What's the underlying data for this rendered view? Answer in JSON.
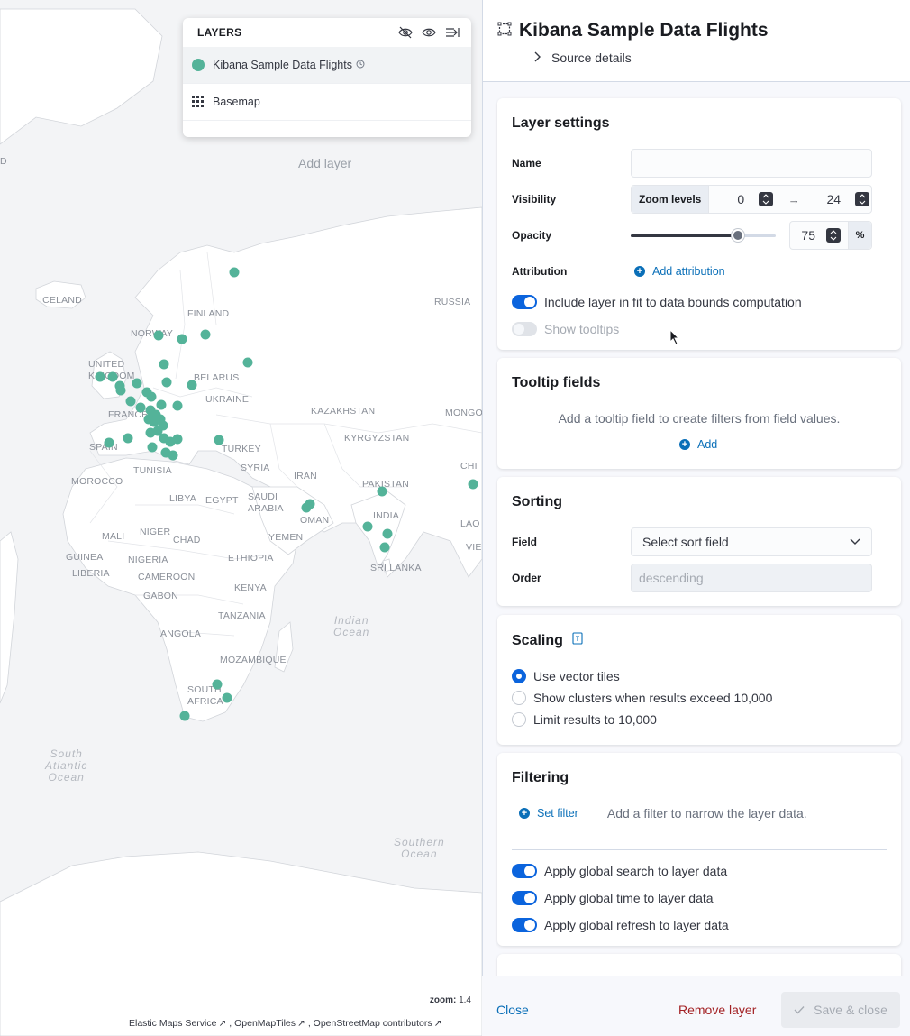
{
  "map": {
    "countries": [
      "ICELAND",
      "FINLAND",
      "NORWAY",
      "UNITED KINGDOM",
      "BELARUS",
      "UKRAINE",
      "FRANCE",
      "SPAIN",
      "TURKEY",
      "TUNISIA",
      "MOROCCO",
      "LIBYA",
      "EGYPT",
      "SAUDI ARABIA",
      "IRAN",
      "OMAN",
      "YEMEN",
      "MALI",
      "NIGER",
      "CHAD",
      "GUINEA",
      "NIGERIA",
      "LIBERIA",
      "CAMEROON",
      "ETHIOPIA",
      "GABON",
      "KENYA",
      "TANZANIA",
      "ANGOLA",
      "MOZAMBIQUE",
      "SOUTH AFRICA",
      "RUSSIA",
      "KAZAKHSTAN",
      "MONGOLIA",
      "KYRGYZSTAN",
      "PAKISTAN",
      "INDIA",
      "SRI LANKA",
      "SYRIA",
      "CHINA",
      "LAOS",
      "VIETNAM"
    ],
    "oceans": [
      "Indian Ocean",
      "South Atlantic Ocean",
      "Southern Ocean"
    ],
    "add_layer_label": "Add layer",
    "zoom_label": "zoom:",
    "zoom_value": "1.4",
    "attribution": [
      "Elastic Maps Service",
      "OpenMapTiles",
      "OpenStreetMap contributors"
    ],
    "point_color": "#54b399"
  },
  "layers_panel": {
    "title": "LAYERS",
    "icons": [
      "eye-closed-icon",
      "eye-icon",
      "collapse-panel-icon"
    ],
    "items": [
      {
        "label": "Kibana Sample Data Flights",
        "selected": true
      },
      {
        "label": "Basemap",
        "selected": false
      }
    ]
  },
  "editor": {
    "title": "Kibana Sample Data Flights",
    "source_details": "Source details",
    "layer_settings": {
      "heading": "Layer settings",
      "name_label": "Name",
      "name_value": "",
      "visibility_label": "Visibility",
      "zoom_levels_label": "Zoom levels",
      "zoom_min": "0",
      "zoom_max": "24",
      "arrow": "→",
      "opacity_label": "Opacity",
      "opacity_value": "75",
      "opacity_fraction": 0.75,
      "opacity_unit": "%",
      "attribution_label": "Attribution",
      "add_attribution": "Add attribution",
      "fit_bounds_label": "Include layer in fit to data bounds computation",
      "fit_bounds_on": true,
      "show_tooltips_label": "Show tooltips",
      "show_tooltips_on": false
    },
    "tooltip_fields": {
      "heading": "Tooltip fields",
      "description": "Add a tooltip field to create filters from field values.",
      "add_label": "Add"
    },
    "sorting": {
      "heading": "Sorting",
      "field_label": "Field",
      "field_placeholder": "Select sort field",
      "order_label": "Order",
      "order_value": "descending"
    },
    "scaling": {
      "heading": "Scaling",
      "options": [
        {
          "label": "Use vector tiles",
          "selected": true
        },
        {
          "label": "Show clusters when results exceed 10,000",
          "selected": false
        },
        {
          "label": "Limit results to 10,000",
          "selected": false
        }
      ]
    },
    "filtering": {
      "heading": "Filtering",
      "set_filter": "Set filter",
      "description": "Add a filter to narrow the layer data.",
      "toggles": [
        {
          "label": "Apply global search to layer data",
          "on": true
        },
        {
          "label": "Apply global time to layer data",
          "on": true
        },
        {
          "label": "Apply global refresh to layer data",
          "on": true
        }
      ]
    }
  },
  "footer": {
    "close": "Close",
    "remove": "Remove layer",
    "save": "Save & close"
  },
  "colors": {
    "accent": "#0b64dd",
    "link": "#0a6fb8",
    "danger": "#a32225",
    "points": "#54b399"
  }
}
